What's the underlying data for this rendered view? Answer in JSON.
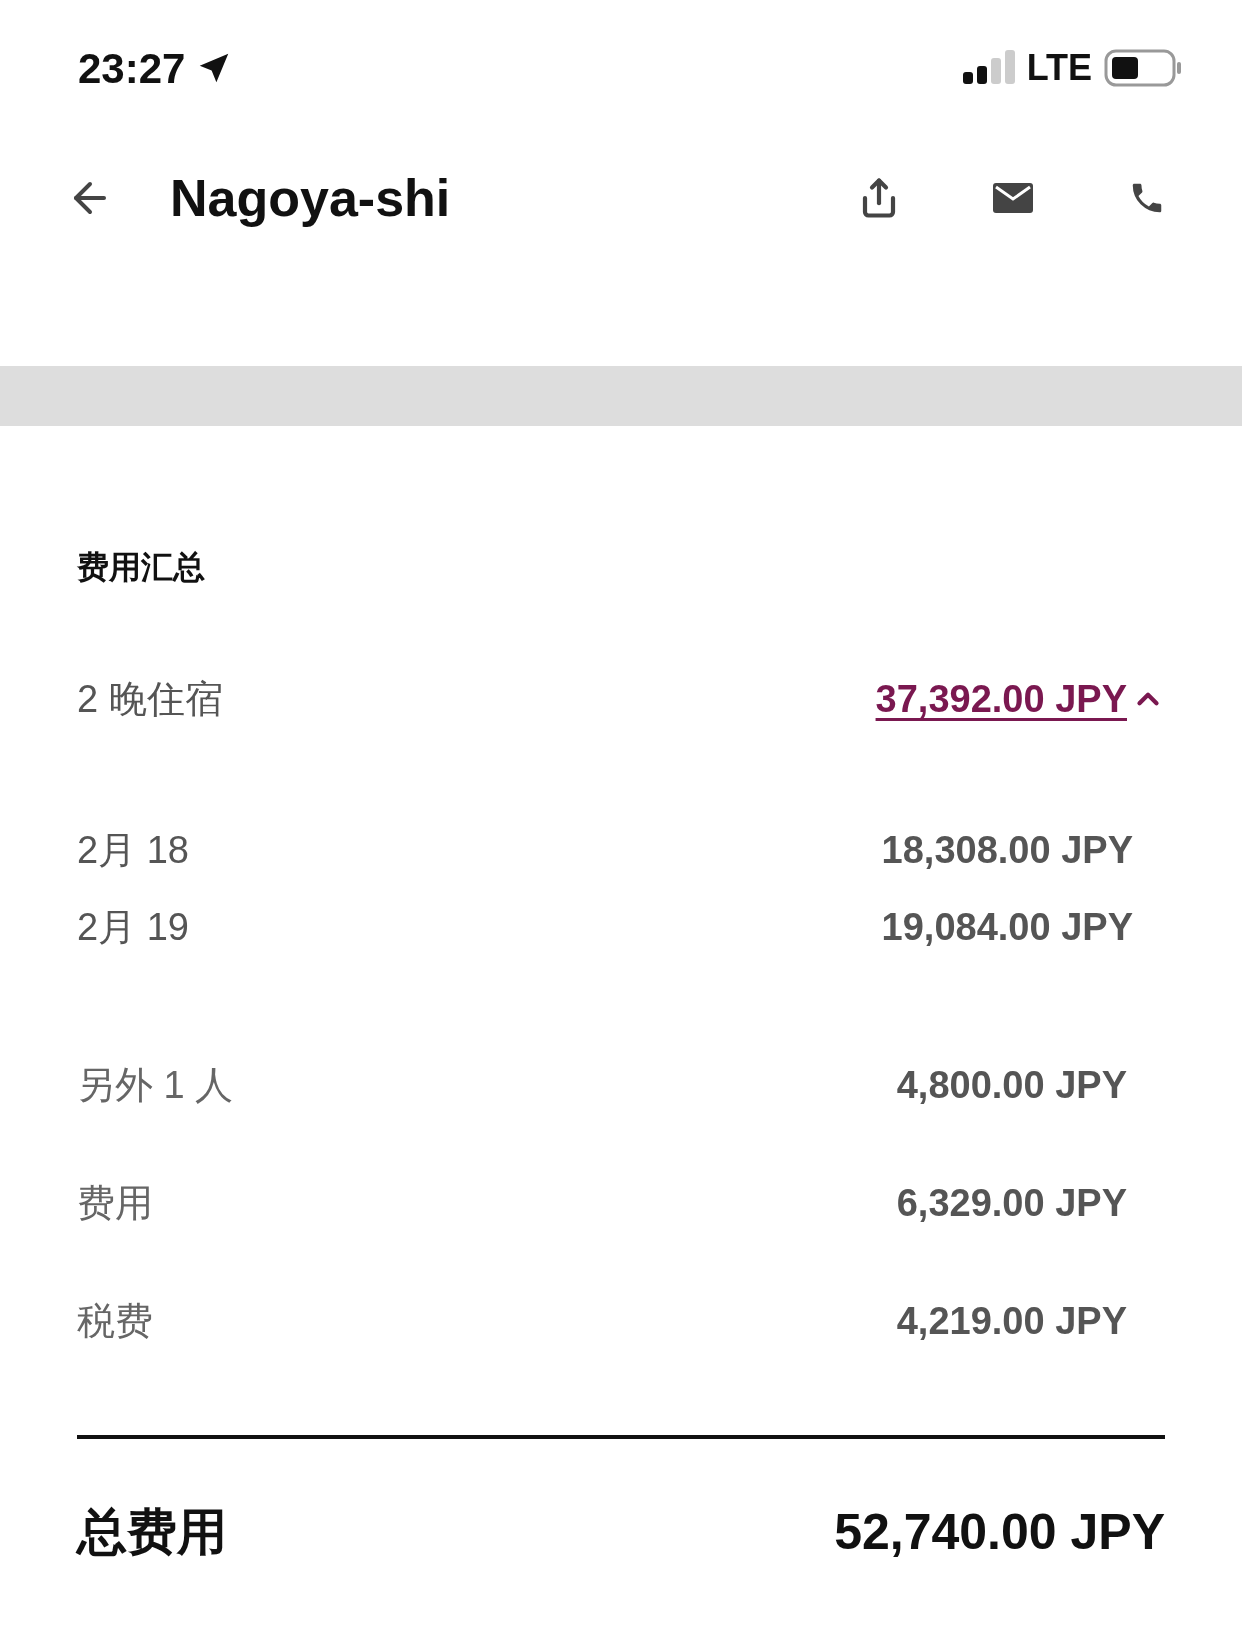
{
  "status_bar": {
    "time": "23:27",
    "network": "LTE"
  },
  "header": {
    "title": "Nagoya-shi"
  },
  "summary": {
    "title": "费用汇总",
    "stay": {
      "label": "2 晚住宿",
      "amount": "37,392.00 JPY",
      "expanded": true
    },
    "nights": [
      {
        "date": "2月 18",
        "amount": "18,308.00 JPY"
      },
      {
        "date": "2月 19",
        "amount": "19,084.00 JPY"
      }
    ],
    "extras": [
      {
        "label": "另外 1 人",
        "amount": "4,800.00 JPY"
      },
      {
        "label": "费用",
        "amount": "6,329.00 JPY"
      },
      {
        "label": "税费",
        "amount": "4,219.00 JPY"
      }
    ],
    "total": {
      "label": "总费用",
      "amount": "52,740.00 JPY"
    }
  }
}
